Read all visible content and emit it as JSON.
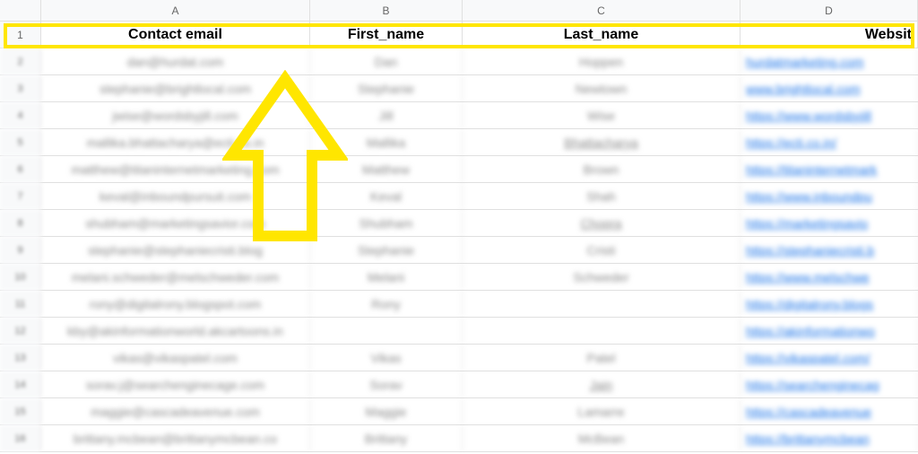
{
  "columns": {
    "A": "A",
    "B": "B",
    "C": "C",
    "D": "D"
  },
  "header_row_num": "1",
  "headers": {
    "contact_email": "Contact email",
    "first_name": "First_name",
    "last_name": "Last_name",
    "website": "Websit"
  },
  "rows": [
    {
      "n": "2",
      "email": "dan@hurdat.com",
      "first": "Dan",
      "last": "Hoppen",
      "site": "hurdatmarketing.com"
    },
    {
      "n": "3",
      "email": "stephanie@brightlocal.com",
      "first": "Stephanie",
      "last": "Newtown",
      "site": "www.brightlocal.com"
    },
    {
      "n": "4",
      "email": "jwise@wordsbyjill.com",
      "first": "Jill",
      "last": "Wise",
      "site": "https://www.wordsbyjill"
    },
    {
      "n": "5",
      "email": "mallika.bhattacharya@ecti.co.in",
      "first": "Mallika",
      "last": "Bhattacharya",
      "site": "https://ecti.co.in/"
    },
    {
      "n": "6",
      "email": "matthew@titaninternetmarketing.com",
      "first": "Matthew",
      "last": "Brown",
      "site": "https://titaninternetmark"
    },
    {
      "n": "7",
      "email": "keval@inboundpursuit.com",
      "first": "Keval",
      "last": "Shah",
      "site": "https://www.inboundpu"
    },
    {
      "n": "8",
      "email": "shubham@marketingsavior.com",
      "first": "Shubham",
      "last": "Chopra",
      "site": "https://marketingsavio"
    },
    {
      "n": "9",
      "email": "stephanie@stephaniecristi.blog",
      "first": "Stephanie",
      "last": "Cristi",
      "site": "https://stephaniecristi.b"
    },
    {
      "n": "10",
      "email": "melani.schweder@melschweder.com",
      "first": "Melani",
      "last": "Schweder",
      "site": "https://www.melschwe"
    },
    {
      "n": "11",
      "email": "rony@digitalrony.blogspot.com",
      "first": "Rony",
      "last": "",
      "site": "https://digitalrony.blogs"
    },
    {
      "n": "12",
      "email": "kby@akinformationworld.akcartoons.in",
      "first": "",
      "last": "",
      "site": "https://akinformationwo"
    },
    {
      "n": "13",
      "email": "vikas@vikaspatel.com",
      "first": "Vikas",
      "last": "Patel",
      "site": "https://vikaspatel.com/"
    },
    {
      "n": "14",
      "email": "sorav.j@searchenginecage.com",
      "first": "Sorav",
      "last": "Jain",
      "site": "https://searchenginecag"
    },
    {
      "n": "15",
      "email": "maggie@cascadeavenue.com",
      "first": "Maggie",
      "last": "Lamarre",
      "site": "https://cascadeavenue"
    },
    {
      "n": "16",
      "email": "brittany.mcbean@brittanymcbean.co",
      "first": "Brittany",
      "last": "McBean",
      "site": "https://brittanymcbean"
    }
  ]
}
